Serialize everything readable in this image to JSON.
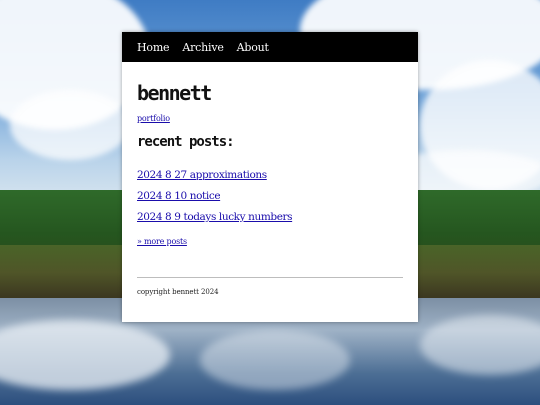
{
  "nav": {
    "items": [
      {
        "label": "Home"
      },
      {
        "label": "Archive"
      },
      {
        "label": "About"
      }
    ]
  },
  "site": {
    "title": "bennett",
    "portfolio_link": "portfolio"
  },
  "recent": {
    "heading": "recent posts:",
    "posts": [
      {
        "title": "2024 8 27 approximations"
      },
      {
        "title": "2024 8 10 notice"
      },
      {
        "title": "2024 8 9 todays lucky numbers"
      }
    ],
    "more_link": "» more posts"
  },
  "footer": {
    "text": "copyright bennett 2024"
  },
  "colors": {
    "nav_background": "#000000",
    "card_background": "#ffffff",
    "link": "#1a0dab"
  }
}
